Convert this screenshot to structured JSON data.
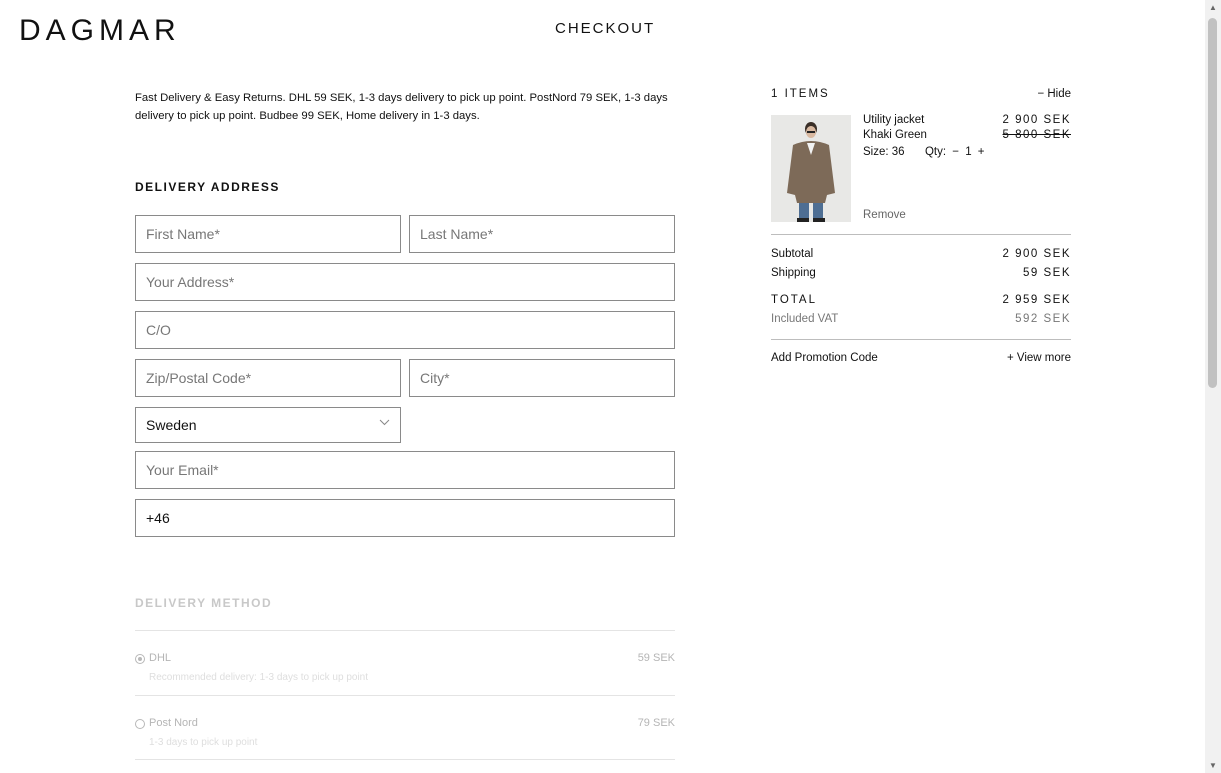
{
  "header": {
    "logo": "DAGMAR",
    "title": "CHECKOUT"
  },
  "info_text": "Fast Delivery & Easy Returns. DHL 59 SEK, 1-3 days delivery to pick up point. PostNord 79 SEK, 1-3 days delivery to pick up point. Budbee 99 SEK, Home delivery in 1-3 days.",
  "delivery_address": {
    "title": "DELIVERY ADDRESS",
    "first_name_placeholder": "First Name*",
    "last_name_placeholder": "Last Name*",
    "address_placeholder": "Your Address*",
    "co_placeholder": "C/O",
    "zip_placeholder": "Zip/Postal Code*",
    "city_placeholder": "City*",
    "country_value": "Sweden",
    "email_placeholder": "Your Email*",
    "phone_value": "+46"
  },
  "delivery_method": {
    "title": "DELIVERY METHOD",
    "options": [
      {
        "name": "DHL",
        "price": "59 SEK",
        "description": "Recommended delivery: 1-3 days to pick up point",
        "selected": true
      },
      {
        "name": "Post Nord",
        "price": "79 SEK",
        "description": "1-3 days to pick up point",
        "selected": false
      }
    ]
  },
  "summary": {
    "items_count": "1 ITEMS",
    "hide_label": "− Hide",
    "product": {
      "name": "Utility jacket",
      "color": "Khaki Green",
      "size_label": "Size: 36",
      "qty_label": "Qty:",
      "qty_minus": "−",
      "qty_value": "1",
      "qty_plus": "+",
      "price": "2 900 SEK",
      "old_price": "5 800 SEK",
      "remove_label": "Remove"
    },
    "subtotal_label": "Subtotal",
    "subtotal_value": "2 900 SEK",
    "shipping_label": "Shipping",
    "shipping_value": "59 SEK",
    "total_label": "TOTAL",
    "total_value": "2 959 SEK",
    "vat_label": "Included VAT",
    "vat_value": "592 SEK",
    "promo_label": "Add Promotion Code",
    "view_more_label": "+ View more"
  },
  "colors": {
    "text": "#111111",
    "border": "#8a8a8a",
    "muted": "#777777",
    "disabled": "#c8c8c8"
  }
}
